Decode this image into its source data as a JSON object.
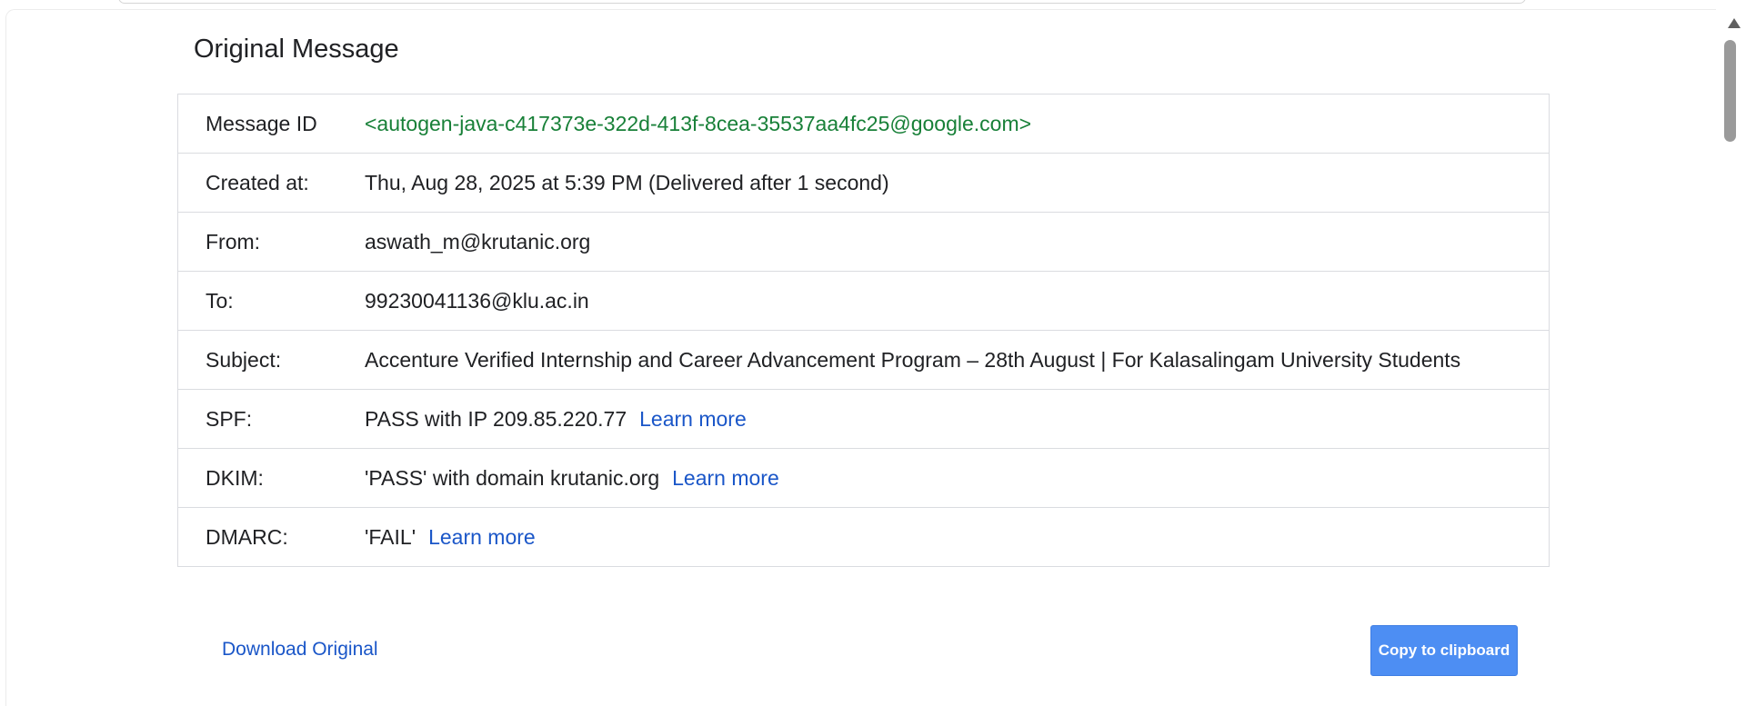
{
  "title": "Original Message",
  "rows": [
    {
      "label": "Message ID",
      "value": "<autogen-java-c417373e-322d-413f-8cea-35537aa4fc25@google.com>"
    },
    {
      "label": "Created at:",
      "value": "Thu, Aug 28, 2025 at 5:39 PM (Delivered after 1 second)"
    },
    {
      "label": "From:",
      "value": "aswath_m@krutanic.org"
    },
    {
      "label": "To:",
      "value": "99230041136@klu.ac.in"
    },
    {
      "label": "Subject:",
      "value": "Accenture Verified Internship and Career Advancement Program – 28th August | For Kalasalingam University Students"
    },
    {
      "label": "SPF:",
      "value": "PASS with IP 209.85.220.77",
      "link": "Learn more"
    },
    {
      "label": "DKIM:",
      "value": "'PASS' with domain krutanic.org",
      "link": "Learn more"
    },
    {
      "label": "DMARC:",
      "value": "'FAIL'",
      "link": "Learn more"
    }
  ],
  "actions": {
    "download_label": "Download Original",
    "copy_label": "Copy to clipboard"
  },
  "colors": {
    "message_id": "#188038",
    "link": "#1a56c8",
    "copy_button": "#4d8ef3"
  }
}
